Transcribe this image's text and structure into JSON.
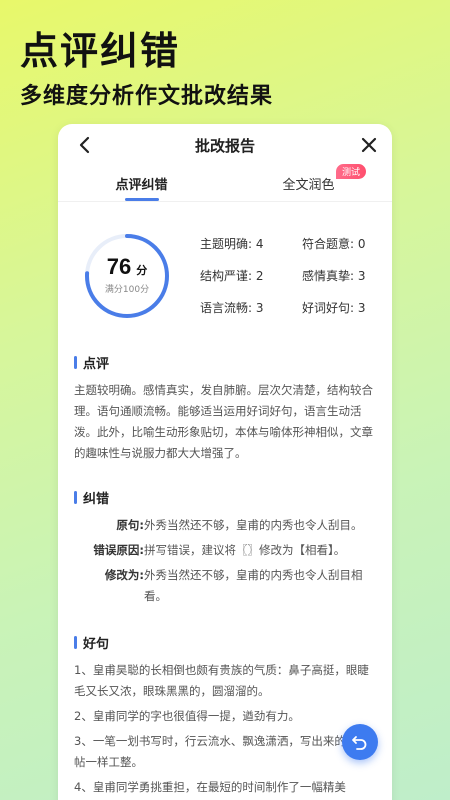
{
  "hero": {
    "title": "点评纠错",
    "subtitle": "多维度分析作文批改结果"
  },
  "nav": {
    "title": "批改报告",
    "back_icon": "back-arrow-icon",
    "close_icon": "close-icon"
  },
  "tabs": [
    {
      "label": "点评纠错",
      "active": true
    },
    {
      "label": "全文润色",
      "active": false,
      "badge": "测试"
    }
  ],
  "score": {
    "value": "76",
    "unit": "分",
    "full": "满分100分",
    "fraction": 0.76,
    "ring_color": "#4a7de8"
  },
  "metrics": [
    {
      "label": "主题明确: 4"
    },
    {
      "label": "符合题意: 0"
    },
    {
      "label": "结构严谨: 2"
    },
    {
      "label": "感情真挚: 3"
    },
    {
      "label": "语言流畅: 3"
    },
    {
      "label": "好词好句: 3"
    }
  ],
  "review": {
    "title": "点评",
    "text": "主题较明确。感情真实，发自肺腑。层次欠清楚，结构较合理。语句通顺流畅。能够适当运用好词好句，语言生动活泼。此外，比喻生动形象贴切，本体与喻体形神相似，文章的趣味性与说服力都大大增强了。"
  },
  "correction": {
    "title": "纠错",
    "rows": [
      {
        "label": "原句:",
        "value": "外秀当然还不够，皇甫的内秀也令人刮目。"
      },
      {
        "label": "错误原因:",
        "value": "拼写错误，建议将〖〗修改为【相看】。"
      },
      {
        "label": "修改为:",
        "value": "外秀当然还不够，皇甫的内秀也令人刮目相看。"
      }
    ]
  },
  "good_sentences": {
    "title": "好句",
    "items": [
      "1、皇甫昊聪的长相倒也颇有贵族的气质：鼻子高挺，眼睫毛又长又浓，眼珠黑黑的，圆溜溜的。",
      "2、皇甫同学的字也很值得一提，遒劲有力。",
      "3、一笔一划书写时，行云流水、飘逸潇洒，写出来的像字帖一样工整。",
      "4、皇甫同学勇挑重担，在最短的时间制作了一幅精美"
    ]
  },
  "fab": {
    "icon": "undo-icon",
    "color": "#3d7bf0"
  }
}
